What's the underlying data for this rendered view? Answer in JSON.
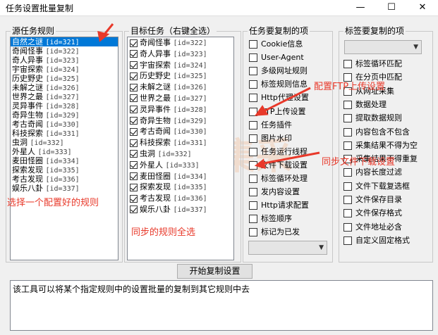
{
  "window": {
    "title": "任务设置批量复制",
    "minimize_glyph": "—",
    "maximize_glyph": "☐",
    "close_glyph": "✕"
  },
  "source_group": {
    "label": "源任务规则",
    "items": [
      {
        "name": "自然之谜",
        "id": "[id=321]",
        "selected": true
      },
      {
        "name": "奇闻怪事",
        "id": "[id=322]"
      },
      {
        "name": "奇人异事",
        "id": "[id=323]"
      },
      {
        "name": "宇宙探索",
        "id": "[id=324]"
      },
      {
        "name": "历史野史",
        "id": "[id=325]"
      },
      {
        "name": "未解之谜",
        "id": "[id=326]"
      },
      {
        "name": "世界之最",
        "id": "[id=327]"
      },
      {
        "name": "灵异事件",
        "id": "[id=328]"
      },
      {
        "name": "奇异生物",
        "id": "[id=329]"
      },
      {
        "name": "考古奇闻",
        "id": "[id=330]"
      },
      {
        "name": "科技探索",
        "id": "[id=331]"
      },
      {
        "name": "虫洞",
        "id": "[id=332]"
      },
      {
        "name": "外星人",
        "id": "[id=333]"
      },
      {
        "name": "麦田怪圈",
        "id": "[id=334]"
      },
      {
        "name": "探索发现",
        "id": "[id=335]"
      },
      {
        "name": "考古发现",
        "id": "[id=336]"
      },
      {
        "name": "娱乐八卦",
        "id": "[id=337]"
      }
    ]
  },
  "target_group": {
    "label": "目标任务（右键全选）",
    "items": [
      {
        "name": "奇闻怪事",
        "id": "[id=322]",
        "checked": true
      },
      {
        "name": "奇人异事",
        "id": "[id=323]",
        "checked": true
      },
      {
        "name": "宇宙探索",
        "id": "[id=324]",
        "checked": true
      },
      {
        "name": "历史野史",
        "id": "[id=325]",
        "checked": true
      },
      {
        "name": "未解之谜",
        "id": "[id=326]",
        "checked": true
      },
      {
        "name": "世界之最",
        "id": "[id=327]",
        "checked": true
      },
      {
        "name": "灵异事件",
        "id": "[id=328]",
        "checked": true
      },
      {
        "name": "奇异生物",
        "id": "[id=329]",
        "checked": true
      },
      {
        "name": "考古奇闻",
        "id": "[id=330]",
        "checked": true
      },
      {
        "name": "科技探索",
        "id": "[id=331]",
        "checked": true
      },
      {
        "name": "虫洞",
        "id": "[id=332]",
        "checked": true
      },
      {
        "name": "外星人",
        "id": "[id=333]",
        "checked": true
      },
      {
        "name": "麦田怪圈",
        "id": "[id=334]",
        "checked": true
      },
      {
        "name": "探索发现",
        "id": "[id=335]",
        "checked": true
      },
      {
        "name": "考古发现",
        "id": "[id=336]",
        "checked": true
      },
      {
        "name": "娱乐八卦",
        "id": "[id=337]",
        "checked": true
      }
    ]
  },
  "task_options_group": {
    "label": "任务要复制的项",
    "items": [
      {
        "label": "Cookie信息",
        "checked": false
      },
      {
        "label": "User-Agent",
        "checked": false
      },
      {
        "label": "多级网址规则",
        "checked": false
      },
      {
        "label": "标签规则信息",
        "checked": false
      },
      {
        "label": "Http代理设置",
        "checked": false
      },
      {
        "label": "FTP上传设置",
        "checked": false
      },
      {
        "label": "任务插件",
        "checked": false
      },
      {
        "label": "图片水印",
        "checked": false
      },
      {
        "label": "任务运行线程",
        "checked": false
      },
      {
        "label": "文件下载设置",
        "checked": false
      },
      {
        "label": "标签循环处理",
        "checked": false
      },
      {
        "label": "发内容设置",
        "checked": false
      },
      {
        "label": "Http请求配置",
        "checked": false
      },
      {
        "label": "标签顺序",
        "checked": false
      },
      {
        "label": "标记为已发",
        "checked": false
      }
    ],
    "combo_value": ""
  },
  "tag_options_group": {
    "label": "标签要复制的项",
    "combo_value": "",
    "items": [
      {
        "label": "标签循环匹配",
        "checked": false
      },
      {
        "label": "在分页中匹配",
        "checked": false
      },
      {
        "label": "从网址采集",
        "checked": false
      },
      {
        "label": "数据处理",
        "checked": false
      },
      {
        "label": "提取数据规则",
        "checked": false
      },
      {
        "label": "内容包含不包含",
        "checked": false
      },
      {
        "label": "采集结果不得为空",
        "checked": false
      },
      {
        "label": "采集结果不得重复",
        "checked": false
      },
      {
        "label": "内容长度过滤",
        "checked": false
      },
      {
        "label": "文件下载复选框",
        "checked": false
      },
      {
        "label": "文件保存目录",
        "checked": false
      },
      {
        "label": "文件保存格式",
        "checked": false
      },
      {
        "label": "文件地址必含",
        "checked": false
      },
      {
        "label": "自定义固定格式",
        "checked": false
      }
    ]
  },
  "start_button": {
    "label": "开始复制设置"
  },
  "description": "该工具可以将某个指定规则中的设置批量的复制到其它规则中去",
  "annotations": {
    "select_rule": "选择一个配置好的规则",
    "sync_all": "同步的规则全选",
    "ftp": "配置FTP上传设置",
    "download": "同步文件下载设置"
  },
  "watermark": "Ⓚ 集采",
  "colors": {
    "annotation": "#e8392a",
    "selection": "#0078d7"
  }
}
